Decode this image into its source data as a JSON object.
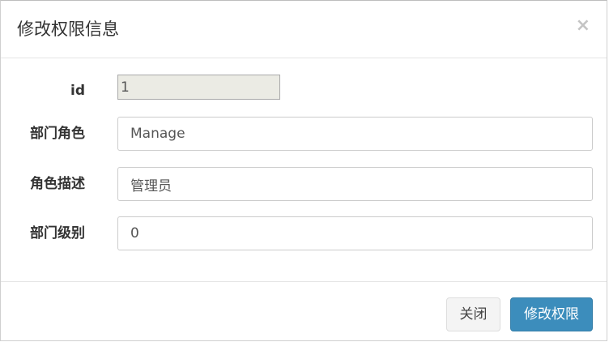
{
  "modal": {
    "title": "修改权限信息",
    "close_symbol": "×"
  },
  "form": {
    "fields": [
      {
        "label": "id",
        "value": "1"
      },
      {
        "label": "部门角色",
        "value": "Manage"
      },
      {
        "label": "角色描述",
        "value": "管理员"
      },
      {
        "label": "部门级别",
        "value": "0"
      }
    ]
  },
  "footer": {
    "close_label": "关闭",
    "submit_label": "修改权限"
  },
  "colors": {
    "primary": "#3c8dbc",
    "readonly_bg": "#ebebe4"
  }
}
